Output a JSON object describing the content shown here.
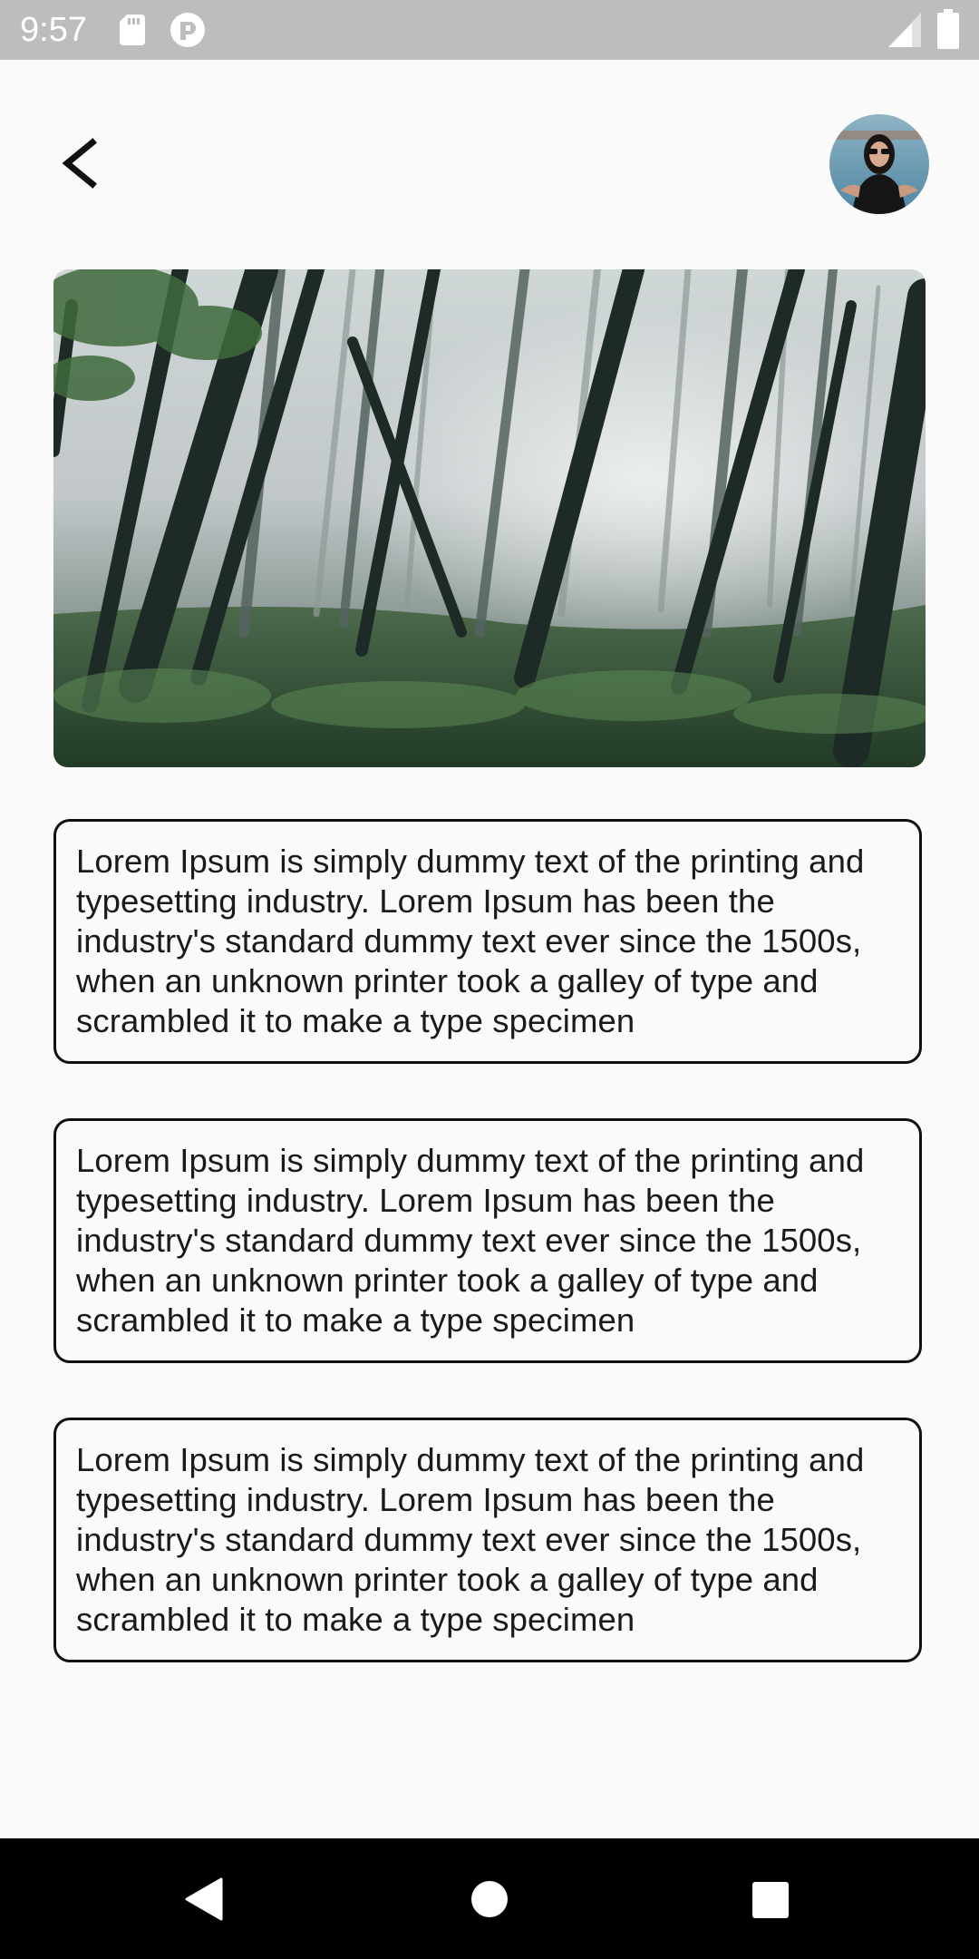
{
  "status_bar": {
    "time": "9:57",
    "left_icons": [
      "sd-card-icon",
      "app-notification-icon"
    ],
    "right_icons": [
      "cellular-signal-icon",
      "battery-icon"
    ]
  },
  "header": {
    "back_icon": "chevron-left-icon",
    "avatar": "user-avatar"
  },
  "hero": {
    "image": "misty-forest-photo"
  },
  "cards": [
    {
      "text": "Lorem Ipsum is simply dummy text of the printing and typesetting industry. Lorem Ipsum has been the industry's standard dummy text ever since the 1500s, when an unknown printer took a galley of type and scrambled it to make a type specimen"
    },
    {
      "text": "Lorem Ipsum is simply dummy text of the printing and typesetting industry. Lorem Ipsum has been the industry's standard dummy text ever since the 1500s, when an unknown printer took a galley of type and scrambled it to make a type specimen"
    },
    {
      "text": "Lorem Ipsum is simply dummy text of the printing and typesetting industry. Lorem Ipsum has been the industry's standard dummy text ever since the 1500s, when an unknown printer took a galley of type and scrambled it to make a type specimen"
    }
  ],
  "nav_bar": {
    "buttons": [
      "back-triangle-icon",
      "home-circle-icon",
      "recents-square-icon"
    ]
  },
  "colors": {
    "background": "#fafafa",
    "status_bar": "#bdbdbd",
    "nav_bar": "#000000",
    "card_border": "#111111",
    "text": "#1a1a1a"
  }
}
